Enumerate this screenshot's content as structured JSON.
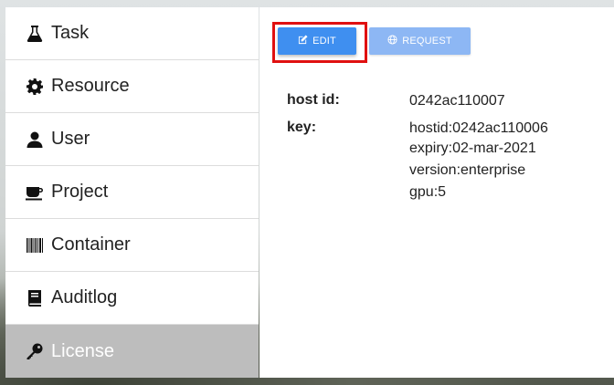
{
  "sidebar": {
    "items": [
      {
        "label": "Task",
        "icon": "flask-icon",
        "active": false
      },
      {
        "label": "Resource",
        "icon": "gear-icon",
        "active": false
      },
      {
        "label": "User",
        "icon": "user-icon",
        "active": false
      },
      {
        "label": "Project",
        "icon": "coffee-cup-icon",
        "active": false
      },
      {
        "label": "Container",
        "icon": "barcode-icon",
        "active": false
      },
      {
        "label": "Auditlog",
        "icon": "book-icon",
        "active": false
      },
      {
        "label": "License",
        "icon": "key-icon",
        "active": true
      }
    ]
  },
  "toolbar": {
    "edit_label": "EDIT",
    "edit_icon": "edit-icon",
    "request_label": "REQUEST",
    "request_icon": "globe-icon"
  },
  "license": {
    "host_id_label": "host id:",
    "host_id_value": "0242ac110007",
    "key_label": "key:",
    "key_lines": [
      "hostid:0242ac110006",
      "expiry:02-mar-2021",
      "version:enterprise",
      "gpu:5"
    ]
  },
  "colors": {
    "primary_button": "#3f8ff0",
    "disabled_button": "#8db7f4",
    "active_nav_bg": "#bdbdbd",
    "highlight_border": "#e01010"
  }
}
